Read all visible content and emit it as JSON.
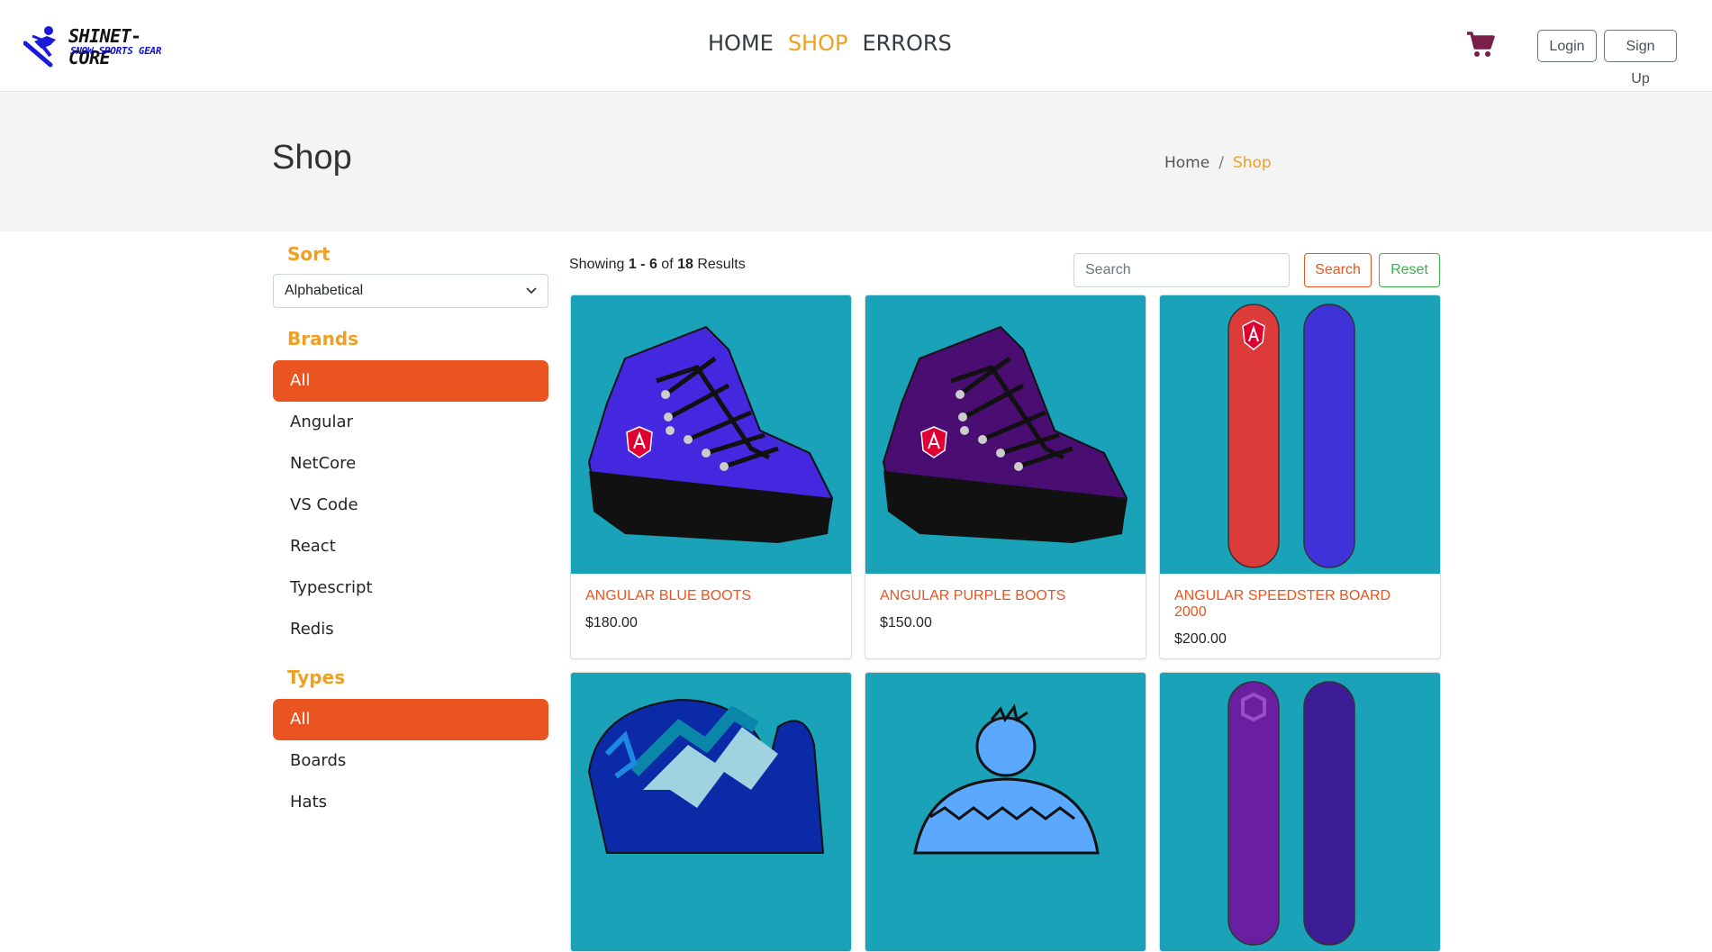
{
  "brand": {
    "line1": "SHINET-CORE",
    "line2": "SNOW SPORTS GEAR"
  },
  "nav": {
    "home": "HOME",
    "shop": "SHOP",
    "errors": "ERRORS"
  },
  "auth": {
    "login": "Login",
    "signup": "Sign Up"
  },
  "page": {
    "title": "Shop",
    "breadcrumb_home": "Home",
    "breadcrumb_sep": "/",
    "breadcrumb_current": "Shop"
  },
  "sidebar": {
    "sort_title": "Sort",
    "sort_value": "Alphabetical",
    "brands_title": "Brands",
    "brands": [
      "All",
      "Angular",
      "NetCore",
      "VS Code",
      "React",
      "Typescript",
      "Redis"
    ],
    "types_title": "Types",
    "types": [
      "All",
      "Boards",
      "Hats"
    ]
  },
  "results": {
    "prefix": "Showing",
    "range": "1 - 6",
    "of": "of",
    "total": "18",
    "suffix": "Results"
  },
  "search": {
    "placeholder": "Search",
    "search_label": "Search",
    "reset_label": "Reset"
  },
  "products": [
    {
      "name": "Angular Blue Boots",
      "price": "$180.00"
    },
    {
      "name": "Angular Purple Boots",
      "price": "$150.00"
    },
    {
      "name": "Angular Speedster Board 2000",
      "price": "$200.00"
    },
    {
      "name": "",
      "price": ""
    },
    {
      "name": "",
      "price": ""
    },
    {
      "name": "",
      "price": ""
    }
  ],
  "colors": {
    "accent": "#e95420",
    "active_nav": "#f0a020",
    "card_bg": "#19a2b8",
    "success": "#38b44a",
    "cart": "#7a1f4a"
  }
}
